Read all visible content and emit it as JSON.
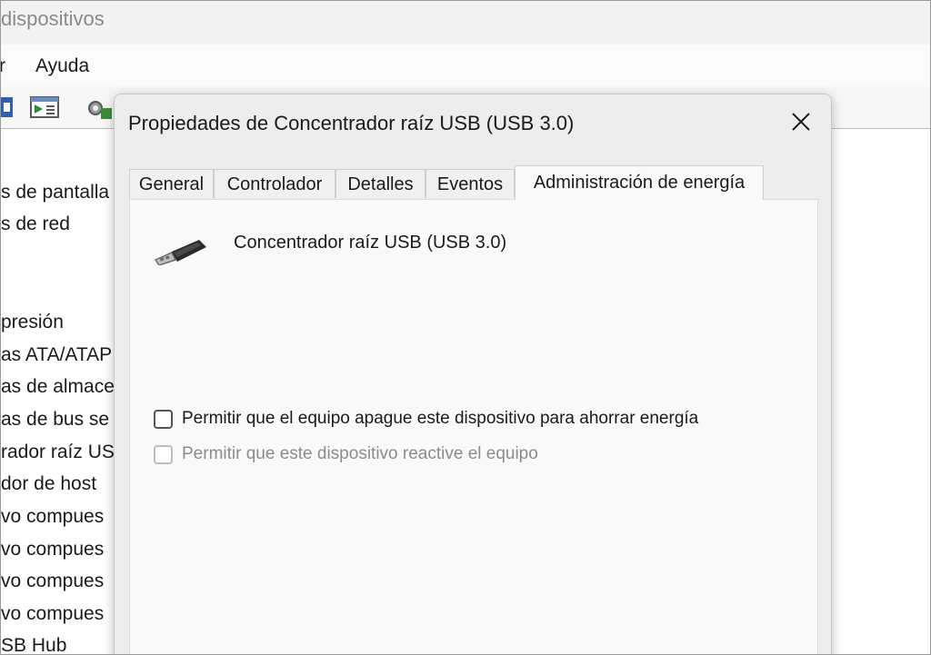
{
  "background_window": {
    "title": "dispositivos",
    "menu": [
      "r",
      "Ayuda"
    ],
    "tree_items": [
      "s de pantalla",
      "s de red",
      "presión",
      "as ATA/ATAPI",
      "as de almace",
      "as de bus se",
      "rador raíz US",
      "dor de host",
      "vo compues",
      "vo compues",
      "vo compues",
      "vo compues",
      "SB Hub"
    ]
  },
  "dialog": {
    "title": "Propiedades de Concentrador raíz USB (USB 3.0)",
    "tabs": [
      "General",
      "Controlador",
      "Detalles",
      "Eventos",
      "Administración de energía"
    ],
    "active_tab": "Administración de energía",
    "device_name": "Concentrador raíz USB (USB 3.0)",
    "device_icon": "usb-plug-icon",
    "options": [
      {
        "label": "Permitir que el equipo apague este dispositivo para ahorrar energía",
        "checked": false,
        "enabled": true
      },
      {
        "label": "Permitir que este dispositivo reactive el equipo",
        "checked": false,
        "enabled": false
      }
    ]
  },
  "colors": {
    "dialog_bg": "#ededed",
    "panel_bg": "#f9f9f9",
    "disabled_text": "#8c8c8c"
  }
}
